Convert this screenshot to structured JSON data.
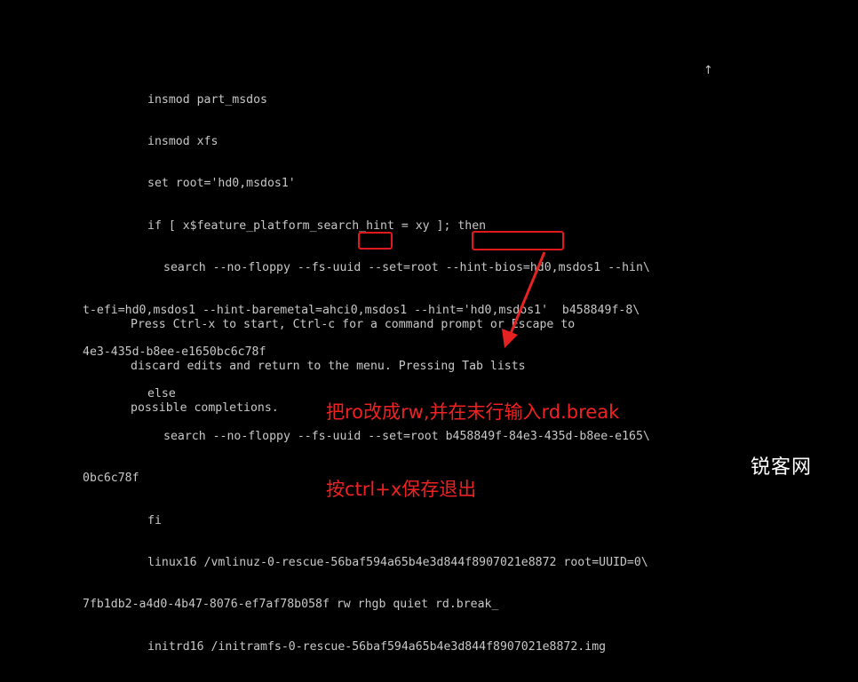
{
  "grub_editor": {
    "lines": [
      "insmod part_msdos",
      "insmod xfs",
      "set root='hd0,msdos1'",
      "if [ x$feature_platform_search_hint = xy ]; then",
      "search --no-floppy --fs-uuid --set=root --hint-bios=hd0,msdos1 --hin\\",
      "t-efi=hd0,msdos1 --hint-baremetal=ahci0,msdos1 --hint='hd0,msdos1'  b458849f-8\\",
      "4e3-435d-b8ee-e1650bc6c78f",
      "else",
      "search --no-floppy --fs-uuid --set=root b458849f-84e3-435d-b8ee-e165\\",
      "0bc6c78f",
      "fi",
      "linux16 /vmlinuz-0-rescue-56baf594a65b4e3d844f8907021e8872 root=UUID=0\\",
      "7fb1db2-a4d0-4b47-8076-ef7af78b058f rw rhgb quiet rd.break_",
      "initrd16 /initramfs-0-rescue-56baf594a65b4e3d844f8907021e8872.img"
    ],
    "scroll_indicator": "↑"
  },
  "help_text": [
    "Press Ctrl-x to start, Ctrl-c for a command prompt or Escape to",
    "discard edits and return to the menu. Pressing Tab lists",
    "possible completions."
  ],
  "annotation": {
    "line1": "把ro改成rw,并在末行输入rd.break",
    "line2": "按ctrl+x保存退出",
    "color": "#ee2222"
  },
  "highlights": {
    "rw_label": "rw",
    "rd_break_label": "rd.break_",
    "color": "#e0191c"
  },
  "watermark": {
    "text": "锐客网"
  }
}
